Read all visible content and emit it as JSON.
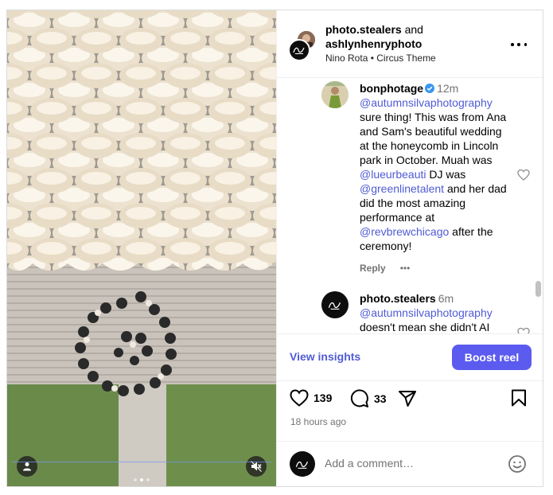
{
  "header": {
    "user1": "photo.stealers",
    "conjunction": "and",
    "user2": "ashlynhenryphoto",
    "audio_artist": "Nino Rota",
    "separator": "•",
    "audio_title": "Circus Theme"
  },
  "comments": [
    {
      "username": "bonphotage",
      "verified": true,
      "time": "12m",
      "mention_1": "@autumnsilvaphotography",
      "text_1": "sure thing! This was from Ana and Sam's beautiful wedding at the honeycomb in Lincoln park in October. Muah was",
      "mention_2": "@lueurbeauti",
      "text_2": "DJ was",
      "mention_3": "@greenlinetalent",
      "text_3": "and her dad did the most amazing performance at",
      "mention_4": "@revbrewchicago",
      "text_4": "after the ceremony!",
      "reply_label": "Reply",
      "more_label": "•••"
    },
    {
      "username": "photo.stealers",
      "time": "6m",
      "mention_1": "@autumnsilvaphotography",
      "text_1": "doesn't mean she didn't AI"
    }
  ],
  "insights": {
    "view_label": "View insights",
    "boost_label": "Boost reel"
  },
  "actions": {
    "likes": "139",
    "comments": "33",
    "time_ago": "18 hours ago",
    "icons": [
      "heart-icon",
      "comment-icon",
      "share-icon",
      "bookmark-icon"
    ]
  },
  "add_comment": {
    "placeholder": "Add a comment…"
  },
  "colors": {
    "link": "#4f5bd5",
    "boost_button": "#5b5bf0",
    "verified": "#3897f0"
  }
}
